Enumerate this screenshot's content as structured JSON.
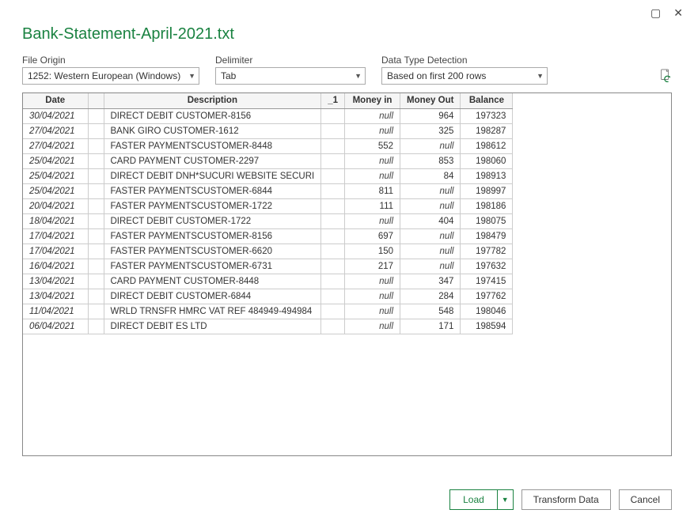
{
  "window": {
    "maximize_glyph": "▢",
    "close_glyph": "✕"
  },
  "title": "Bank-Statement-April-2021.txt",
  "controls": {
    "origin_label": "File Origin",
    "origin_value": "1252: Western European (Windows)",
    "delimiter_label": "Delimiter",
    "delimiter_value": "Tab",
    "detection_label": "Data Type Detection",
    "detection_value": "Based on first 200 rows"
  },
  "table": {
    "headers": {
      "date": "Date",
      "description": "Description",
      "u1": "_1",
      "money_in": "Money in",
      "money_out": "Money Out",
      "balance": "Balance"
    },
    "null_text": "null",
    "rows": [
      {
        "date": "30/04/2021",
        "desc": "DIRECT DEBIT CUSTOMER-8156",
        "in": null,
        "out": 964,
        "bal": 197323
      },
      {
        "date": "27/04/2021",
        "desc": "BANK GIRO CUSTOMER-1612",
        "in": null,
        "out": 325,
        "bal": 198287
      },
      {
        "date": "27/04/2021",
        "desc": "FASTER PAYMENTSCUSTOMER-8448",
        "in": 552,
        "out": null,
        "bal": 198612
      },
      {
        "date": "25/04/2021",
        "desc": "CARD PAYMENT CUSTOMER-2297",
        "in": null,
        "out": 853,
        "bal": 198060
      },
      {
        "date": "25/04/2021",
        "desc": "DIRECT DEBIT DNH*SUCURI WEBSITE SECURI",
        "in": null,
        "out": 84,
        "bal": 198913
      },
      {
        "date": "25/04/2021",
        "desc": "FASTER PAYMENTSCUSTOMER-6844",
        "in": 811,
        "out": null,
        "bal": 198997
      },
      {
        "date": "20/04/2021",
        "desc": "FASTER PAYMENTSCUSTOMER-1722",
        "in": 111,
        "out": null,
        "bal": 198186
      },
      {
        "date": "18/04/2021",
        "desc": "DIRECT DEBIT CUSTOMER-1722",
        "in": null,
        "out": 404,
        "bal": 198075
      },
      {
        "date": "17/04/2021",
        "desc": "FASTER PAYMENTSCUSTOMER-8156",
        "in": 697,
        "out": null,
        "bal": 198479
      },
      {
        "date": "17/04/2021",
        "desc": "FASTER PAYMENTSCUSTOMER-6620",
        "in": 150,
        "out": null,
        "bal": 197782
      },
      {
        "date": "16/04/2021",
        "desc": "FASTER PAYMENTSCUSTOMER-6731",
        "in": 217,
        "out": null,
        "bal": 197632
      },
      {
        "date": "13/04/2021",
        "desc": "CARD PAYMENT CUSTOMER-8448",
        "in": null,
        "out": 347,
        "bal": 197415
      },
      {
        "date": "13/04/2021",
        "desc": "DIRECT DEBIT CUSTOMER-6844",
        "in": null,
        "out": 284,
        "bal": 197762
      },
      {
        "date": "11/04/2021",
        "desc": "WRLD TRNSFR HMRC VAT REF 484949-494984",
        "in": null,
        "out": 548,
        "bal": 198046
      },
      {
        "date": "06/04/2021",
        "desc": "DIRECT DEBIT ES LTD",
        "in": null,
        "out": 171,
        "bal": 198594
      }
    ]
  },
  "footer": {
    "load": "Load",
    "transform": "Transform Data",
    "cancel": "Cancel"
  }
}
